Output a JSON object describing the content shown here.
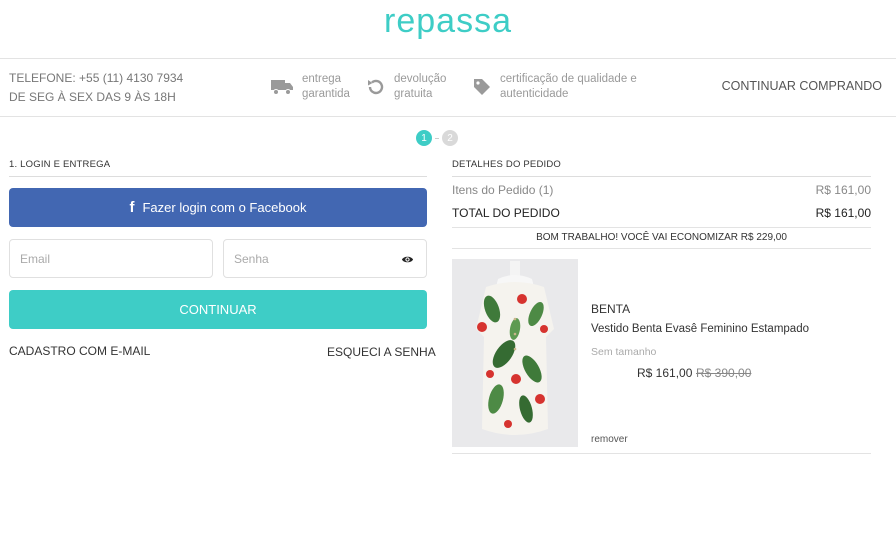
{
  "brand": {
    "logo_text": "repassa",
    "logo_color": "#3ecdc6"
  },
  "topbar": {
    "phone_line1": "TELEFONE: +55 (11) 4130 7934",
    "phone_line2": "DE SEG À SEX DAS 9 ÀS 18H",
    "benefits": [
      {
        "icon": "truck-icon",
        "line1": "entrega",
        "line2": "garantida"
      },
      {
        "icon": "return-icon",
        "line1": "devolução",
        "line2": "gratuita"
      },
      {
        "icon": "tag-icon",
        "line1": "certificação de qualidade e",
        "line2": "autenticidade"
      }
    ],
    "continue_shopping": "CONTINUAR COMPRANDO"
  },
  "steps": {
    "step1": "1",
    "step2": "2",
    "active_color": "#3ecdc6"
  },
  "login": {
    "section_title": "1. LOGIN E ENTREGA",
    "facebook_label": "Fazer login com o Facebook",
    "facebook_icon": "f",
    "facebook_color": "#4267b2",
    "email_placeholder": "Email",
    "password_placeholder": "Senha",
    "continue_label": "CONTINUAR",
    "signup_link": "CADASTRO COM E-MAIL",
    "forgot_link": "ESQUECI A SENHA"
  },
  "order": {
    "section_title": "DETALHES DO PEDIDO",
    "items_label": "Itens do Pedido (1)",
    "items_value": "R$ 161,00",
    "total_label": "TOTAL DO PEDIDO",
    "total_value": "R$ 161,00",
    "savings_text": "BOM TRABALHO! VOCÊ VAI ECONOMIZAR R$ 229,00",
    "product": {
      "brand": "BENTA",
      "name": "Vestido Benta Evasê Feminino Estampado",
      "size": "Sem tamanho",
      "price": "R$ 161,00",
      "old_price": "R$ 390,00",
      "remove_label": "remover"
    }
  }
}
